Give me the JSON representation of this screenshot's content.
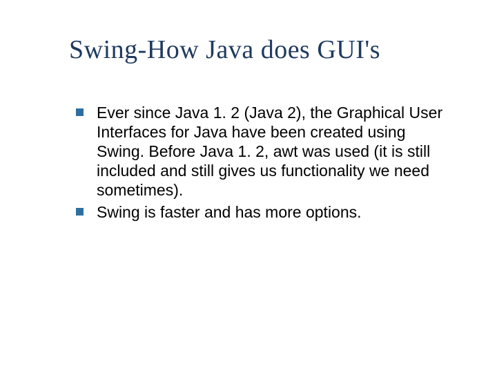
{
  "slide": {
    "title": "Swing-How Java does GUI's",
    "bullets": [
      "Ever since Java 1. 2 (Java 2), the Graphical User Interfaces for Java have been created using Swing. Before Java 1. 2, awt was used (it is still included and still gives us functionality we need sometimes).",
      "Swing is faster and has more options."
    ]
  }
}
